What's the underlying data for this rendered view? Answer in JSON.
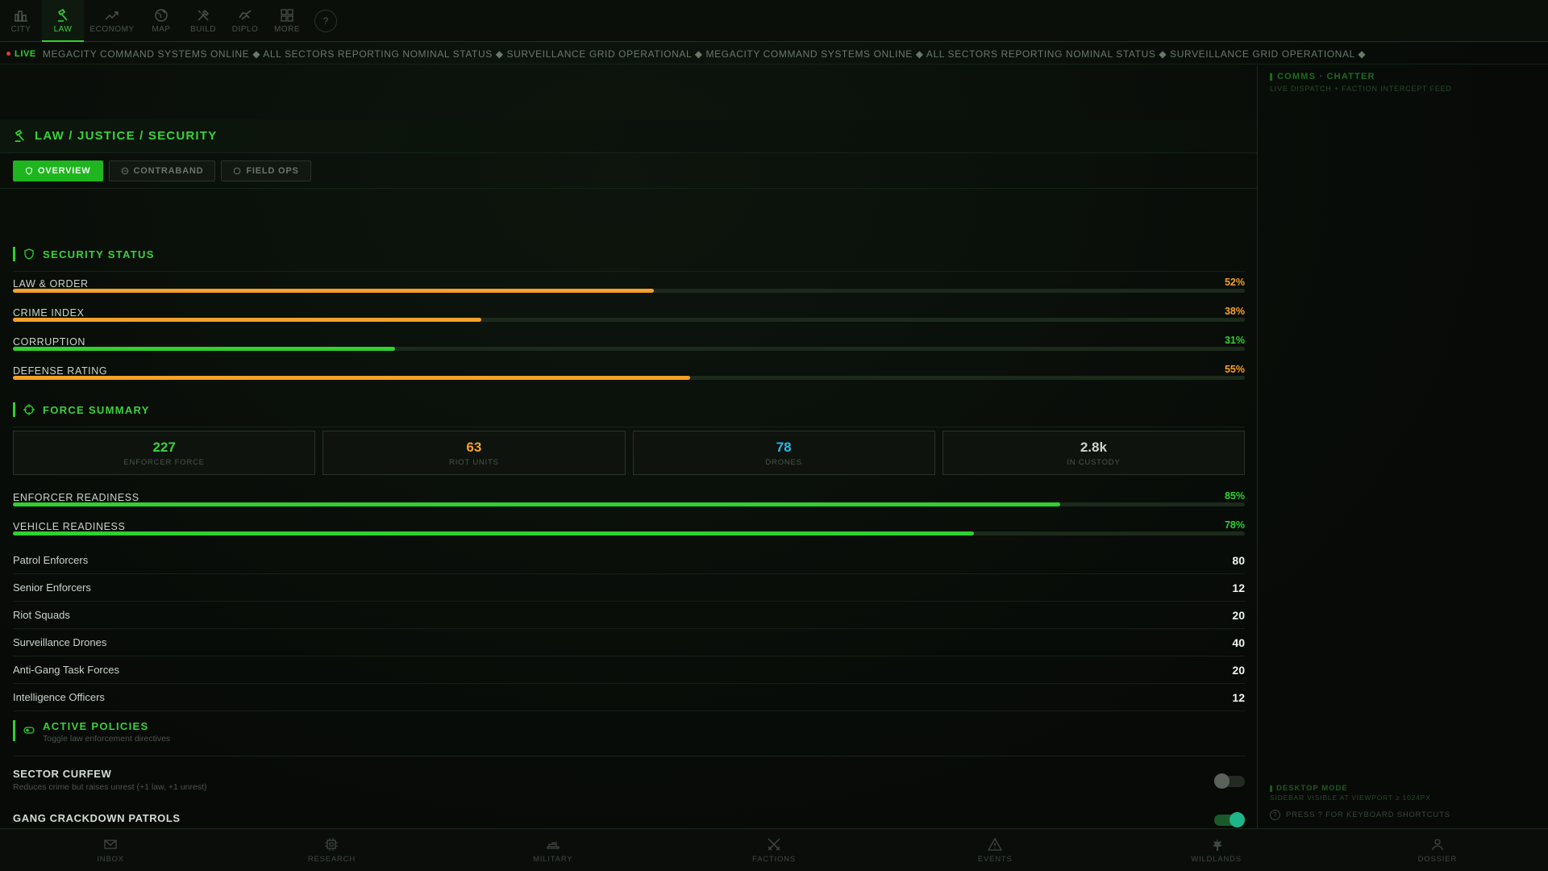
{
  "topnav": {
    "items": [
      {
        "label": "CITY",
        "icon": "city-icon"
      },
      {
        "label": "LAW",
        "icon": "gavel-icon",
        "active": true
      },
      {
        "label": "ECONOMY",
        "icon": "trend-icon"
      },
      {
        "label": "MAP",
        "icon": "globe-icon"
      },
      {
        "label": "BUILD",
        "icon": "tools-icon"
      },
      {
        "label": "DIPLO",
        "icon": "handshake-icon"
      },
      {
        "label": "MORE",
        "icon": "grid-icon"
      }
    ],
    "help": "?"
  },
  "ticker": {
    "live": "LIVE",
    "text": "MEGACITY COMMAND SYSTEMS ONLINE ◆ ALL SECTORS REPORTING NOMINAL STATUS ◆ SURVEILLANCE GRID OPERATIONAL ◆ MEGACITY COMMAND SYSTEMS ONLINE ◆ ALL SECTORS REPORTING NOMINAL STATUS ◆ SURVEILLANCE GRID OPERATIONAL ◆"
  },
  "page": {
    "title": "LAW / JUSTICE / SECURITY",
    "tabs": [
      "OVERVIEW",
      "CONTRABAND",
      "FIELD OPS"
    ]
  },
  "security": {
    "title": "SECURITY STATUS",
    "bars": [
      {
        "label": "LAW & ORDER",
        "value": "52%",
        "pct": 52,
        "color": "#f5a02a"
      },
      {
        "label": "CRIME INDEX",
        "value": "38%",
        "pct": 38,
        "color": "#f5a02a"
      },
      {
        "label": "CORRUPTION",
        "value": "31%",
        "pct": 31,
        "color": "#2fd12f"
      },
      {
        "label": "DEFENSE RATING",
        "value": "55%",
        "pct": 55,
        "color": "#f5a02a"
      }
    ]
  },
  "force": {
    "title": "FORCE SUMMARY",
    "stats": [
      {
        "value": "227",
        "caption": "ENFORCER FORCE",
        "color": "#3ad13a"
      },
      {
        "value": "63",
        "caption": "RIOT UNITS",
        "color": "#f5a02a"
      },
      {
        "value": "78",
        "caption": "DRONES",
        "color": "#2ab8e8"
      },
      {
        "value": "2.8k",
        "caption": "IN CUSTODY",
        "color": "#c9d4c9"
      }
    ],
    "bars": [
      {
        "label": "ENFORCER READINESS",
        "value": "85%",
        "pct": 85,
        "color": "#2fd12f"
      },
      {
        "label": "VEHICLE READINESS",
        "value": "78%",
        "pct": 78,
        "color": "#2fd12f"
      }
    ],
    "units": [
      {
        "label": "Patrol Enforcers",
        "value": "80"
      },
      {
        "label": "Senior Enforcers",
        "value": "12"
      },
      {
        "label": "Riot Squads",
        "value": "20"
      },
      {
        "label": "Surveillance Drones",
        "value": "40"
      },
      {
        "label": "Anti-Gang Task Forces",
        "value": "20"
      },
      {
        "label": "Intelligence Officers",
        "value": "12"
      }
    ]
  },
  "policies": {
    "title": "ACTIVE POLICIES",
    "subtitle": "Toggle law enforcement directives",
    "items": [
      {
        "title": "SECTOR CURFEW",
        "desc": "Reduces crime but raises unrest (+1 law, +1 unrest)",
        "on": false
      },
      {
        "title": "GANG CRACKDOWN PATROLS",
        "desc": "",
        "on": true
      }
    ]
  },
  "sidebar": {
    "title": "COMMS · CHATTER",
    "subtitle": "LIVE DISPATCH + FACTION INTERCEPT FEED",
    "mode_title": "DESKTOP MODE",
    "mode_sub": "SIDEBAR VISIBLE AT VIEWPORT ≥ 1024PX",
    "shortcut_hint": "PRESS ? FOR KEYBOARD SHORTCUTS"
  },
  "bottomnav": {
    "items": [
      {
        "label": "INBOX",
        "icon": "mail-icon"
      },
      {
        "label": "RESEARCH",
        "icon": "chip-icon"
      },
      {
        "label": "MILITARY",
        "icon": "tank-icon"
      },
      {
        "label": "FACTIONS",
        "icon": "swords-icon"
      },
      {
        "label": "EVENTS",
        "icon": "warning-icon"
      },
      {
        "label": "WILDLANDS",
        "icon": "leaf-icon"
      },
      {
        "label": "DOSSIER",
        "icon": "person-icon"
      }
    ]
  }
}
